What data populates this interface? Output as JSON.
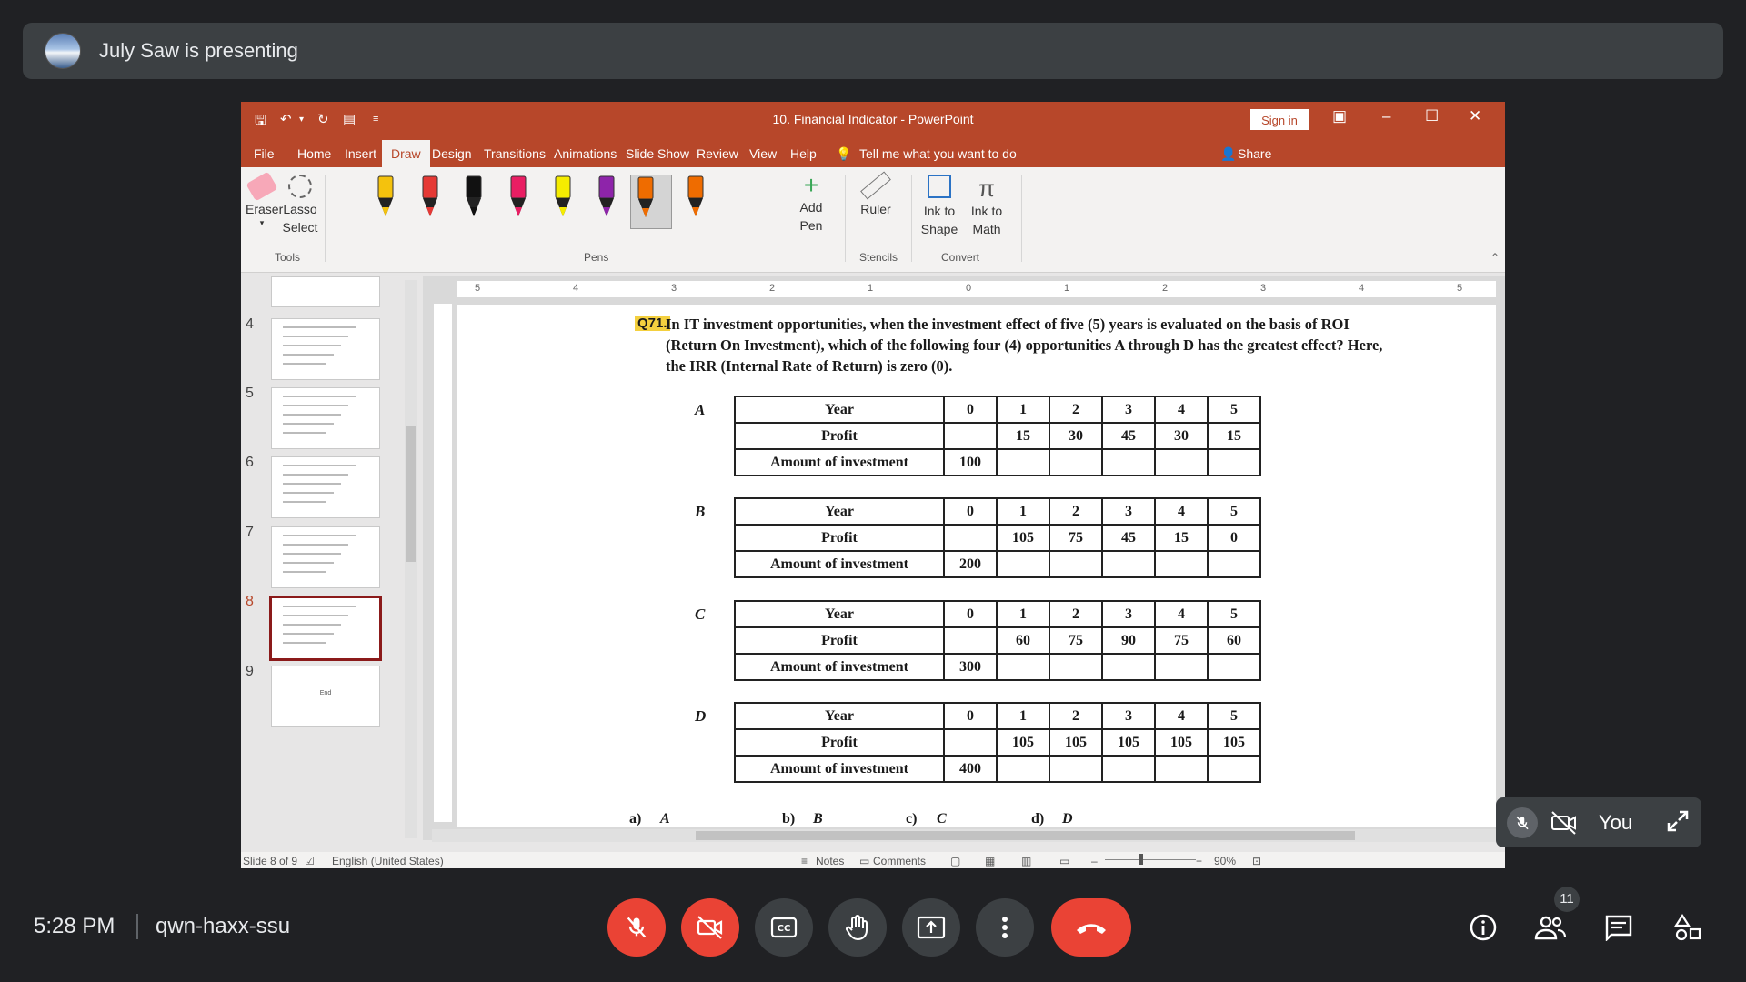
{
  "meet": {
    "presenter_banner": "July Saw is presenting",
    "time": "5:28 PM",
    "meeting_code": "qwn-haxx-ssu",
    "participants_count": "11",
    "self_label": "You"
  },
  "ppt": {
    "title": "10. Financial Indicator  -  PowerPoint",
    "sign_in": "Sign in",
    "tabs": [
      "File",
      "Home",
      "Insert",
      "Draw",
      "Design",
      "Transitions",
      "Animations",
      "Slide Show",
      "Review",
      "View",
      "Help"
    ],
    "tell_me": "Tell me what you want to do",
    "share": "Share",
    "ribbon": {
      "eraser": "Eraser",
      "lasso": "Lasso Select",
      "tools_group": "Tools",
      "pens_group": "Pens",
      "add_pen": "Add Pen",
      "ruler": "Ruler",
      "stencils_group": "Stencils",
      "ink_to_shape": "Ink to Shape",
      "ink_to_math": "Ink to Math",
      "convert_group": "Convert",
      "pen_colors": [
        "#f4c20d",
        "#e53935",
        "#111111",
        "#e91e63",
        "#f5ec00",
        "#8e24aa",
        "#ef6c00",
        "#ef6c00"
      ]
    },
    "thumbs": [
      {
        "num": "4"
      },
      {
        "num": "5"
      },
      {
        "num": "6"
      },
      {
        "num": "7"
      },
      {
        "num": "8"
      },
      {
        "num": "9",
        "text": "End"
      }
    ],
    "ruler_h": [
      "5",
      "4",
      "3",
      "2",
      "1",
      "0",
      "1",
      "2",
      "3",
      "4",
      "5"
    ],
    "status": {
      "slide": "Slide 8 of 9",
      "language": "English (United States)",
      "notes": "Notes",
      "comments": "Comments",
      "zoom": "90%"
    },
    "colors": {
      "accent": "#b7472a"
    }
  },
  "slide": {
    "q_number": "Q71.",
    "question": "In IT investment opportunities, when the investment effect of five (5) years is evaluated on the basis of ROI (Return On Investment), which of the following four (4) opportunities A through D has the greatest effect? Here, the IRR (Internal Rate of Return) is zero (0).",
    "row_headers": [
      "Year",
      "Profit",
      "Amount of investment"
    ],
    "tables": [
      {
        "label": "A",
        "years": [
          "0",
          "1",
          "2",
          "3",
          "4",
          "5"
        ],
        "profit": [
          "",
          "15",
          "30",
          "45",
          "30",
          "15"
        ],
        "investment": "100"
      },
      {
        "label": "B",
        "years": [
          "0",
          "1",
          "2",
          "3",
          "4",
          "5"
        ],
        "profit": [
          "",
          "105",
          "75",
          "45",
          "15",
          "0"
        ],
        "investment": "200"
      },
      {
        "label": "C",
        "years": [
          "0",
          "1",
          "2",
          "3",
          "4",
          "5"
        ],
        "profit": [
          "",
          "60",
          "75",
          "90",
          "75",
          "60"
        ],
        "investment": "300"
      },
      {
        "label": "D",
        "years": [
          "0",
          "1",
          "2",
          "3",
          "4",
          "5"
        ],
        "profit": [
          "",
          "105",
          "105",
          "105",
          "105",
          "105"
        ],
        "investment": "400"
      }
    ],
    "answers": [
      {
        "key": "a)",
        "val": "A"
      },
      {
        "key": "b)",
        "val": "B"
      },
      {
        "key": "c)",
        "val": "C"
      },
      {
        "key": "d)",
        "val": "D"
      }
    ]
  }
}
